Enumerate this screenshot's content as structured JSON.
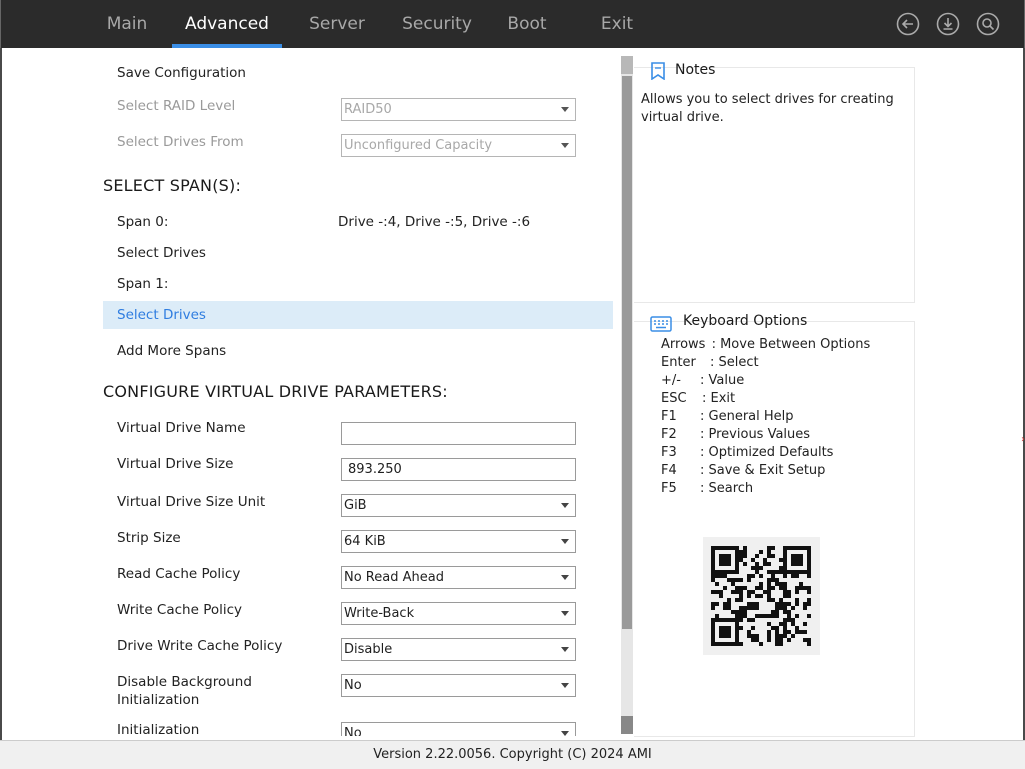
{
  "nav": {
    "tabs": [
      "Main",
      "Advanced",
      "Server",
      "Security",
      "Boot",
      "Exit"
    ],
    "active_index": 1,
    "icons": [
      "back-icon",
      "download-icon",
      "search-icon"
    ]
  },
  "content": {
    "save_configuration": "Save Configuration",
    "raid_level": {
      "label": "Select RAID Level",
      "value": "RAID50"
    },
    "drives_from": {
      "label": "Select Drives From",
      "value": "Unconfigured Capacity"
    },
    "select_spans_heading": "SELECT SPAN(S):",
    "span0": {
      "label": "Span 0:",
      "value": "Drive -:4, Drive -:5, Drive -:6"
    },
    "select_drives_0": "Select Drives",
    "span1": {
      "label": "Span 1:"
    },
    "select_drives_1": "Select Drives",
    "add_more_spans": "Add More Spans",
    "configure_heading": "CONFIGURE VIRTUAL DRIVE PARAMETERS:",
    "params": {
      "vd_name": {
        "label": "Virtual Drive Name",
        "value": ""
      },
      "vd_size": {
        "label": "Virtual Drive Size",
        "value": "893.250"
      },
      "vd_size_unit": {
        "label": "Virtual Drive Size Unit",
        "value": "GiB"
      },
      "strip_size": {
        "label": "Strip Size",
        "value": "64 KiB"
      },
      "read_cache": {
        "label": "Read Cache Policy",
        "value": "No Read Ahead"
      },
      "write_cache": {
        "label": "Write Cache Policy",
        "value": "Write-Back"
      },
      "drive_write_cache": {
        "label": "Drive Write Cache Policy",
        "value": "Disable"
      },
      "disable_bg_init": {
        "label_line1": "Disable Background",
        "label_line2": "Initialization",
        "value": "No"
      },
      "initialization": {
        "label": "Initialization",
        "value": "No"
      }
    }
  },
  "notes": {
    "title": "Notes",
    "text": "Allows you to select drives for creating virtual drive."
  },
  "keyboard": {
    "title": "Keyboard Options",
    "lines": [
      {
        "key": "Arrows",
        "desc": ": Move Between Options"
      },
      {
        "key": "Enter",
        "desc": ": Select"
      },
      {
        "key": "+/-",
        "desc": ": Value"
      },
      {
        "key": "ESC",
        "desc": ": Exit"
      },
      {
        "key": "F1",
        "desc": ": General Help"
      },
      {
        "key": "F2",
        "desc": ": Previous Values"
      },
      {
        "key": "F3",
        "desc": ": Optimized Defaults"
      },
      {
        "key": "F4",
        "desc": ": Save & Exit Setup"
      },
      {
        "key": "F5",
        "desc": ": Search"
      }
    ]
  },
  "footer": {
    "text": "Version 2.22.0056. Copyright (C) 2024 AMI"
  },
  "colors": {
    "accent": "#3a8ee6",
    "topbar": "#2b2b2b",
    "highlight": "#dcecf8",
    "link": "#2f7de0"
  }
}
